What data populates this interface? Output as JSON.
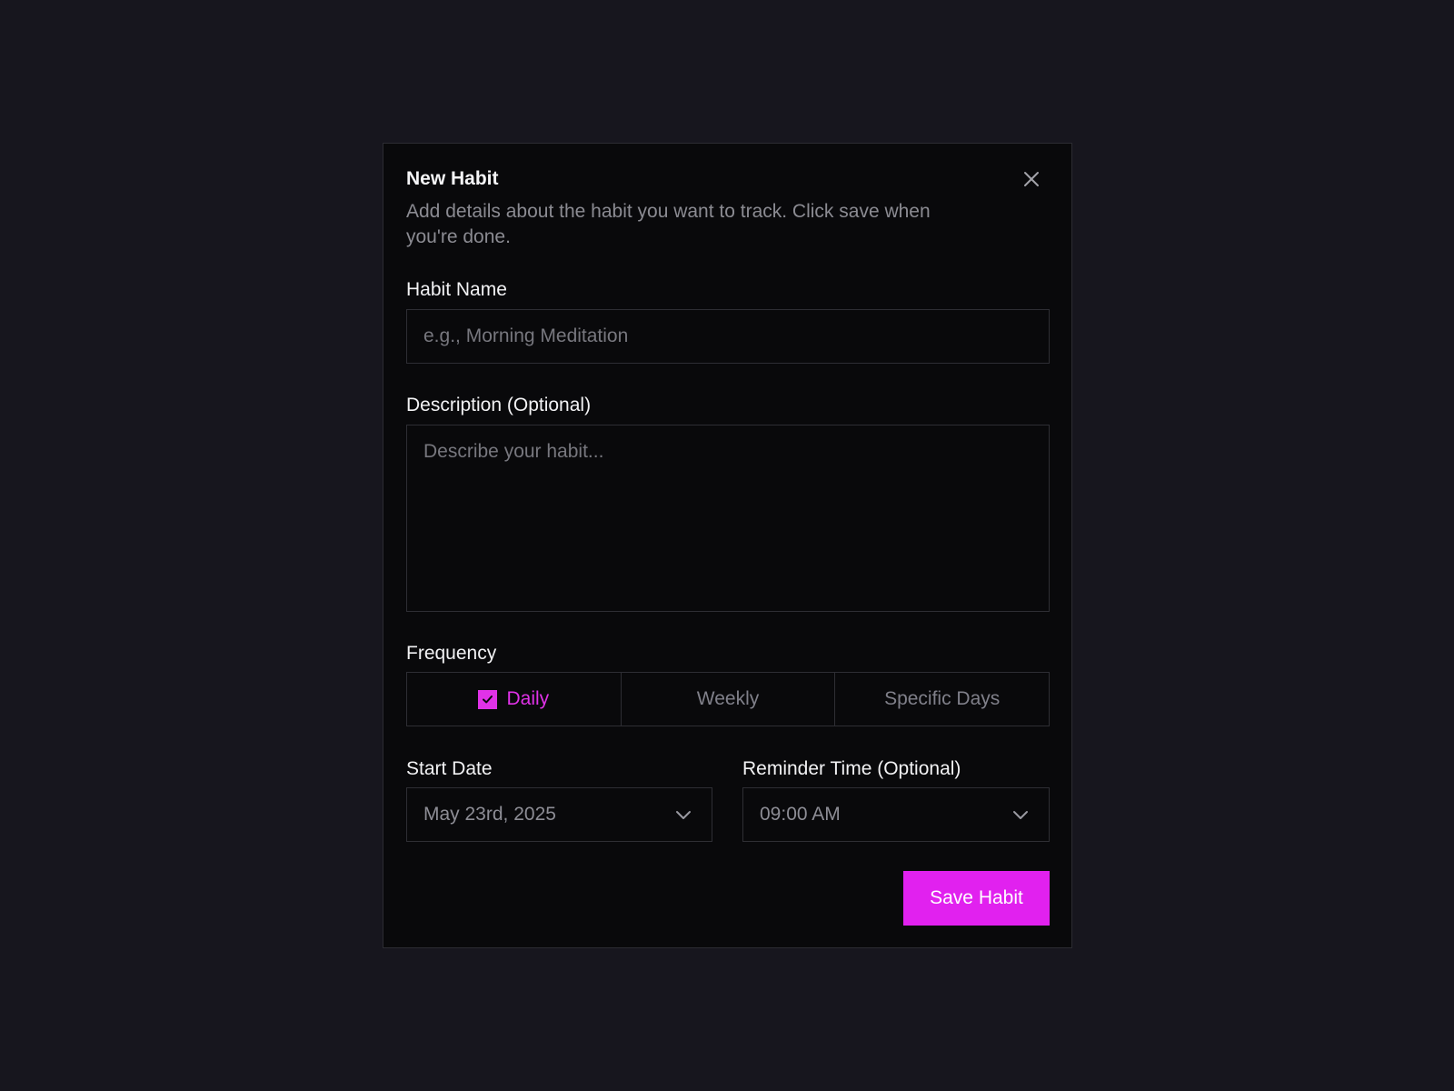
{
  "dialog": {
    "title": "New Habit",
    "description": "Add details about the habit you want to track. Click save when you're done.",
    "close_icon": "close-icon"
  },
  "habit_name": {
    "label": "Habit Name",
    "value": "",
    "placeholder": "e.g., Morning Meditation"
  },
  "description_field": {
    "label": "Description (Optional)",
    "value": "",
    "placeholder": "Describe your habit..."
  },
  "frequency": {
    "label": "Frequency",
    "selected": "Daily",
    "options": [
      "Daily",
      "Weekly",
      "Specific Days"
    ]
  },
  "start_date": {
    "label": "Start Date",
    "value": "May 23rd, 2025",
    "icon": "chevron-down-icon"
  },
  "reminder_time": {
    "label": "Reminder Time (Optional)",
    "value": "09:00 AM",
    "icon": "chevron-down-icon"
  },
  "actions": {
    "save_label": "Save Habit"
  },
  "colors": {
    "accent": "#e121ef",
    "background": "#17161e",
    "dialog_background": "#09090b"
  }
}
